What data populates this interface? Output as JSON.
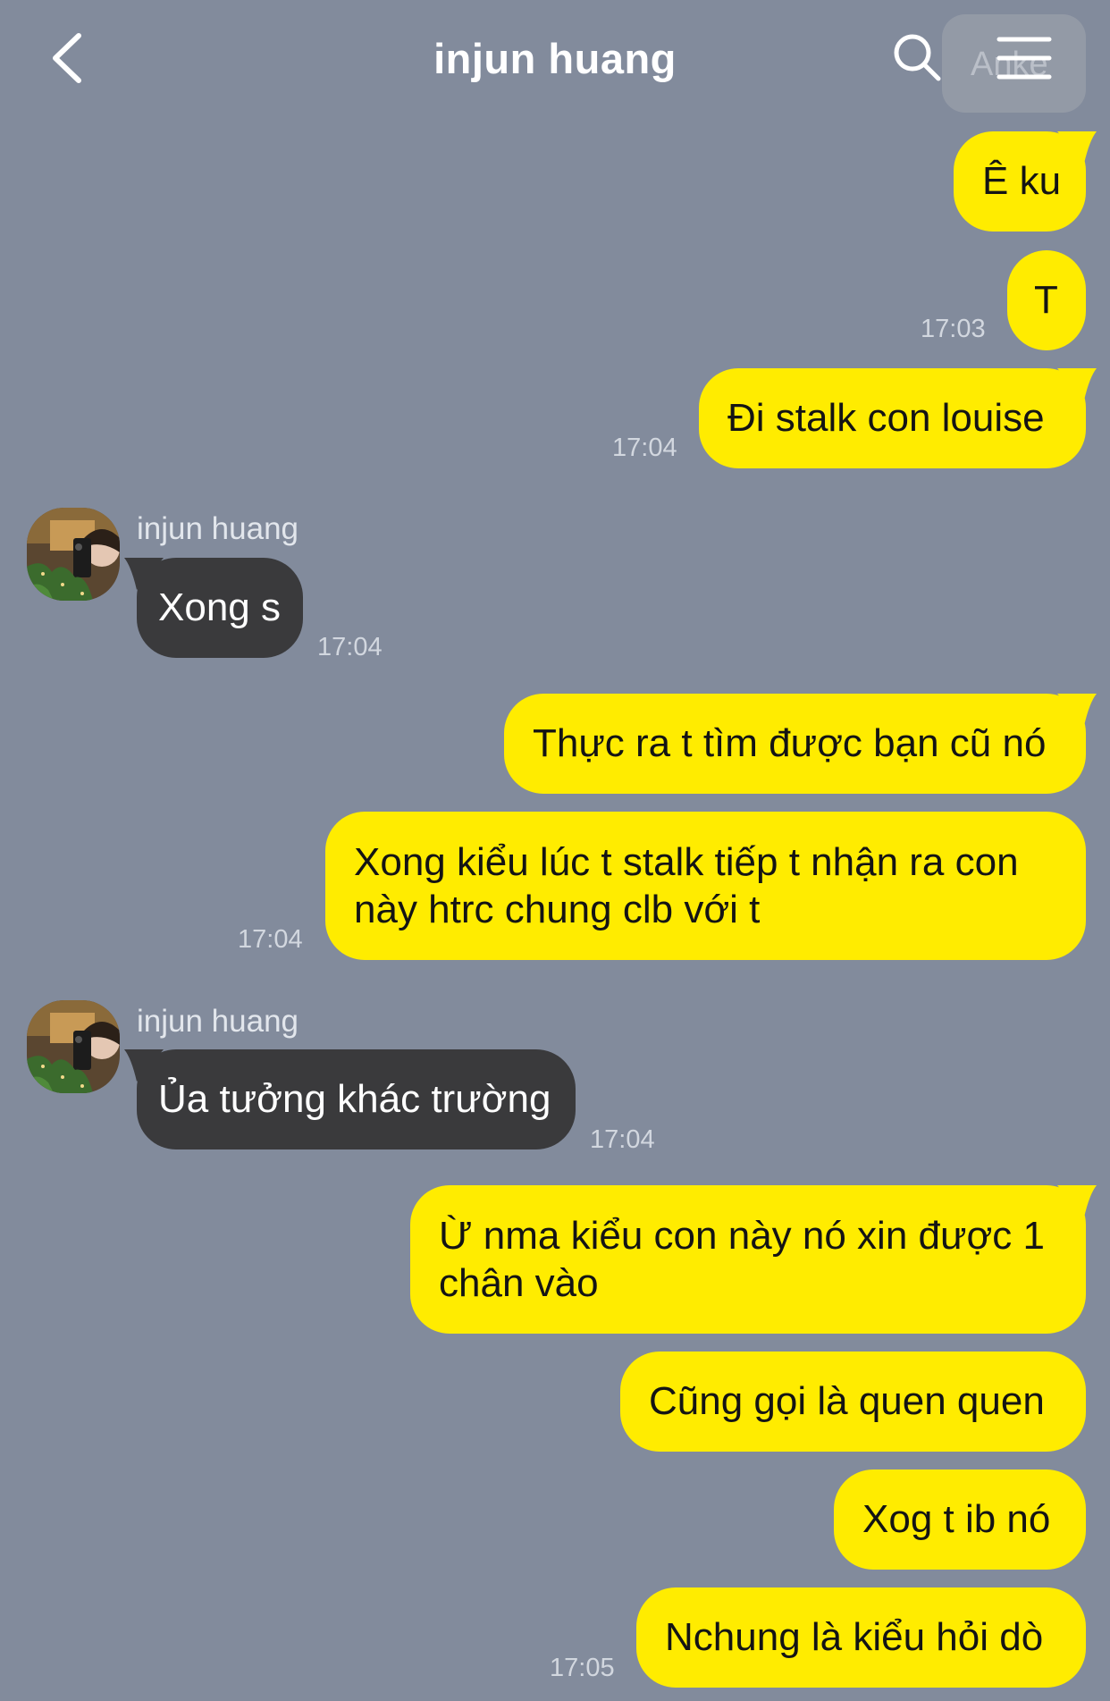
{
  "header": {
    "title": "injun huang",
    "overlay_text": "Anke",
    "back_icon": "chevron-left-icon",
    "search_icon": "search-icon",
    "menu_icon": "hamburger-menu-icon"
  },
  "colors": {
    "background": "#828b9c",
    "outgoing_bubble": "#ffec00",
    "incoming_bubble": "#3a3a3c"
  },
  "messages": [
    {
      "direction": "out",
      "text": "Ê ku",
      "time": ""
    },
    {
      "direction": "out",
      "text": "T",
      "time": "17:03"
    },
    {
      "direction": "out",
      "text": "Đi stalk con louise",
      "time": "17:04"
    },
    {
      "direction": "in",
      "sender": "injun huang",
      "text": "Xong s",
      "time": "17:04"
    },
    {
      "direction": "out",
      "text": "Thực ra t tìm được bạn cũ nó",
      "time": ""
    },
    {
      "direction": "out",
      "text": "Xong kiểu lúc t stalk tiếp t nhận ra con này htrc chung clb với t",
      "time": "17:04"
    },
    {
      "direction": "in",
      "sender": "injun huang",
      "text": "Ủa tưởng khác trường",
      "time": "17:04"
    },
    {
      "direction": "out",
      "text": "Ừ nma kiểu con này nó xin được 1 chân vào",
      "time": ""
    },
    {
      "direction": "out",
      "text": "Cũng gọi là quen quen",
      "time": ""
    },
    {
      "direction": "out",
      "text": "Xog t ib nó",
      "time": ""
    },
    {
      "direction": "out",
      "text": "Nchung là kiểu hỏi dò",
      "time": "17:05"
    }
  ]
}
